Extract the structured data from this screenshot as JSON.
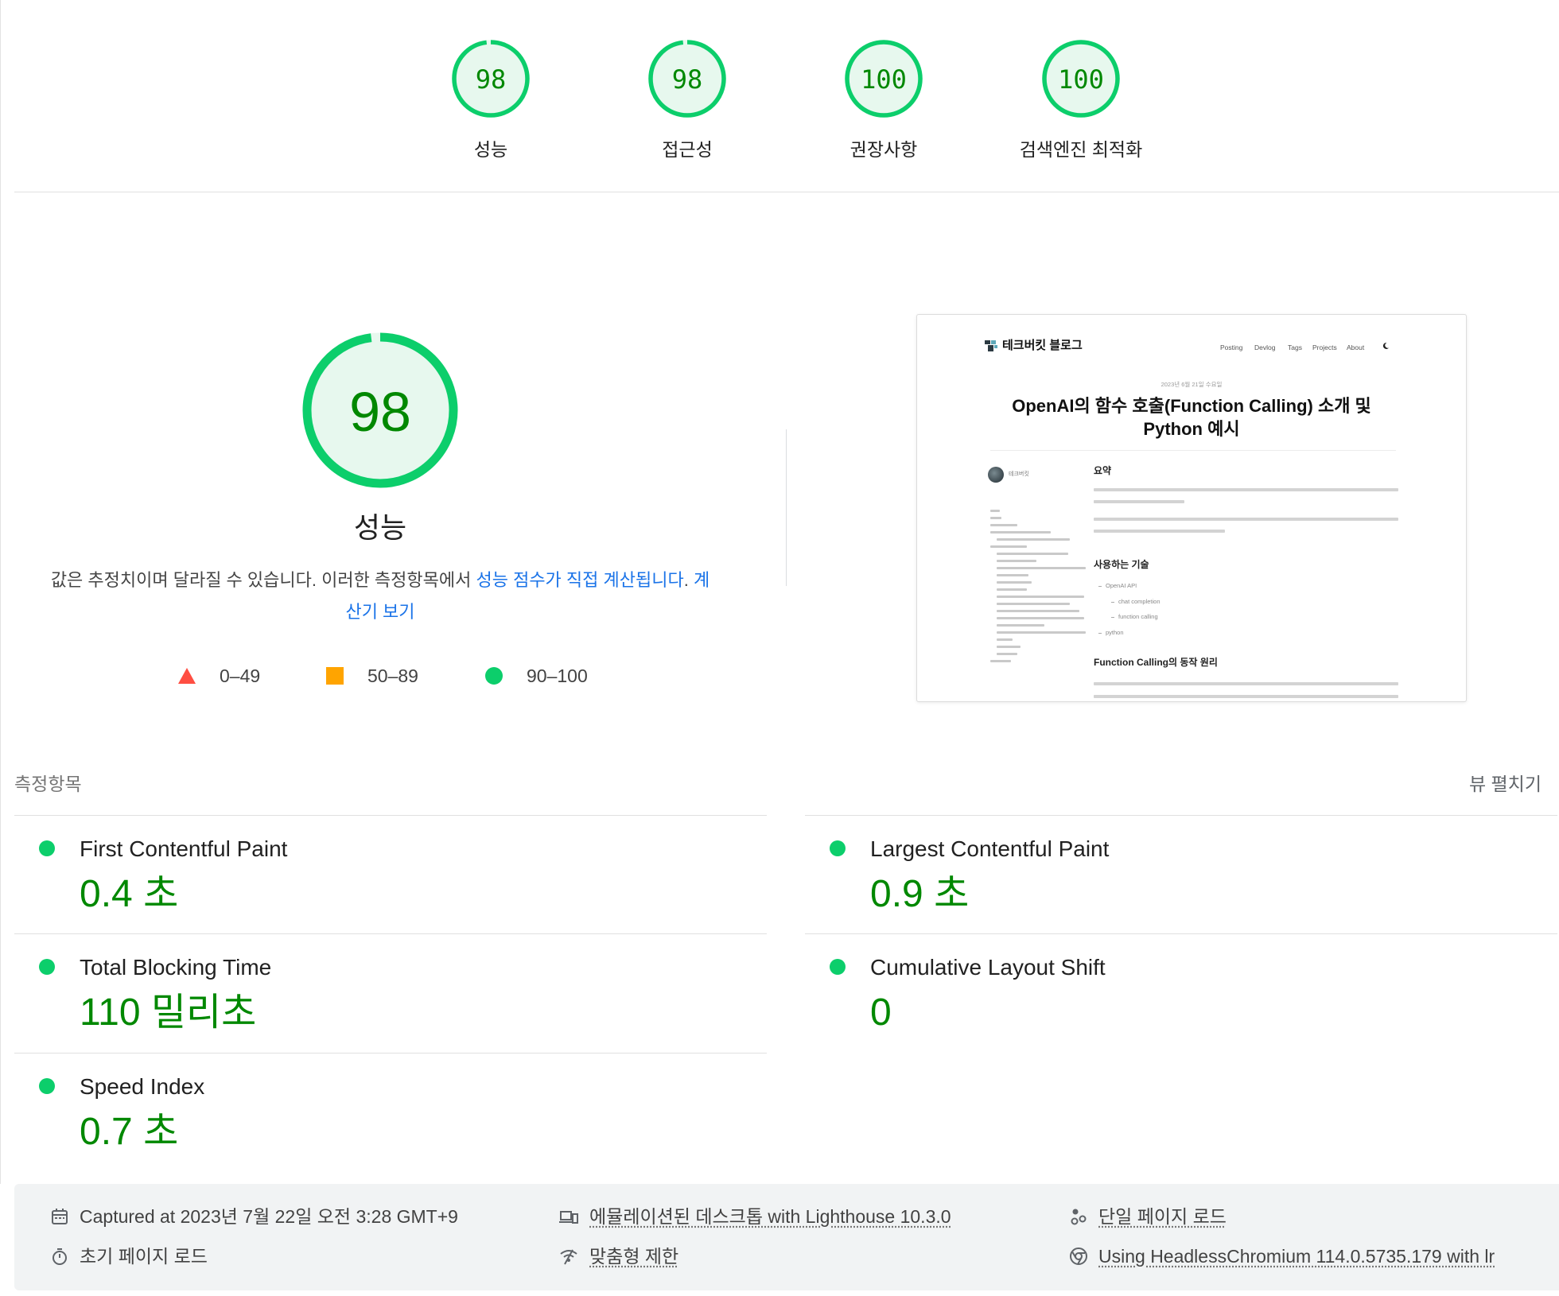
{
  "colors": {
    "pass": "#0cce6b",
    "pass_text": "#008800",
    "pass_fill": "#e7f8ee",
    "average": "#ffa400",
    "fail": "#ff4e42",
    "link": "#1a73e8"
  },
  "categories": [
    {
      "label": "성능",
      "score": 98
    },
    {
      "label": "접근성",
      "score": 98
    },
    {
      "label": "권장사항",
      "score": 100
    },
    {
      "label": "검색엔진 최적화",
      "score": 100
    }
  ],
  "performance": {
    "score": 98,
    "title": "성능",
    "description": {
      "text_before": "값은 추정치이며 달라질 수 있습니다. 이러한 측정항목에서 ",
      "score_link": "성능 점수가 직접 계산됩니다",
      "text_between": ". ",
      "calculator_link": "계산기 보기"
    },
    "legend": [
      {
        "icon": "triangle-icon",
        "range": "0–49"
      },
      {
        "icon": "square-icon",
        "range": "50–89"
      },
      {
        "icon": "circle-icon",
        "range": "90–100"
      }
    ]
  },
  "screenshot": {
    "logo_text": "테크버킷 블로그",
    "nav": [
      "Posting",
      "Devlog",
      "Tags",
      "Projects",
      "About"
    ],
    "date": "2023년 6월 21일 수요일",
    "title_lines": [
      "OpenAI의 함수 호출(Function Calling) 소개 및",
      "Python 예시"
    ],
    "author": "테크버킷",
    "summary_heading": "요약",
    "tech_heading": "사용하는 기술",
    "tech_list": [
      "OpenAI API",
      "chat completion",
      "function calling",
      "python"
    ],
    "principle_heading": "Function Calling의 동작 원리"
  },
  "metrics": {
    "heading": "측정항목",
    "toggle_label": "뷰 펼치기",
    "items": [
      {
        "name": "First Contentful Paint",
        "value": "0.4 초"
      },
      {
        "name": "Largest Contentful Paint",
        "value": "0.9 초"
      },
      {
        "name": "Total Blocking Time",
        "value": "110 밀리초"
      },
      {
        "name": "Cumulative Layout Shift",
        "value": "0"
      },
      {
        "name": "Speed Index",
        "value": "0.7 초"
      }
    ]
  },
  "footer": {
    "items": [
      {
        "icon": "calendar-icon",
        "text": "Captured at 2023년 7월 22일 오전 3:28 GMT+9"
      },
      {
        "icon": "stopwatch-icon",
        "text": "초기 페이지 로드"
      },
      {
        "icon": "devices-icon",
        "text": "에뮬레이션된 데스크톱 with Lighthouse 10.3.0"
      },
      {
        "icon": "network-throttle-icon",
        "text": "맞춤형 제한"
      },
      {
        "icon": "single-page-icon",
        "text": "단일 페이지 로드"
      },
      {
        "icon": "chrome-icon",
        "text": "Using HeadlessChromium 114.0.5735.179 with lr"
      }
    ]
  }
}
